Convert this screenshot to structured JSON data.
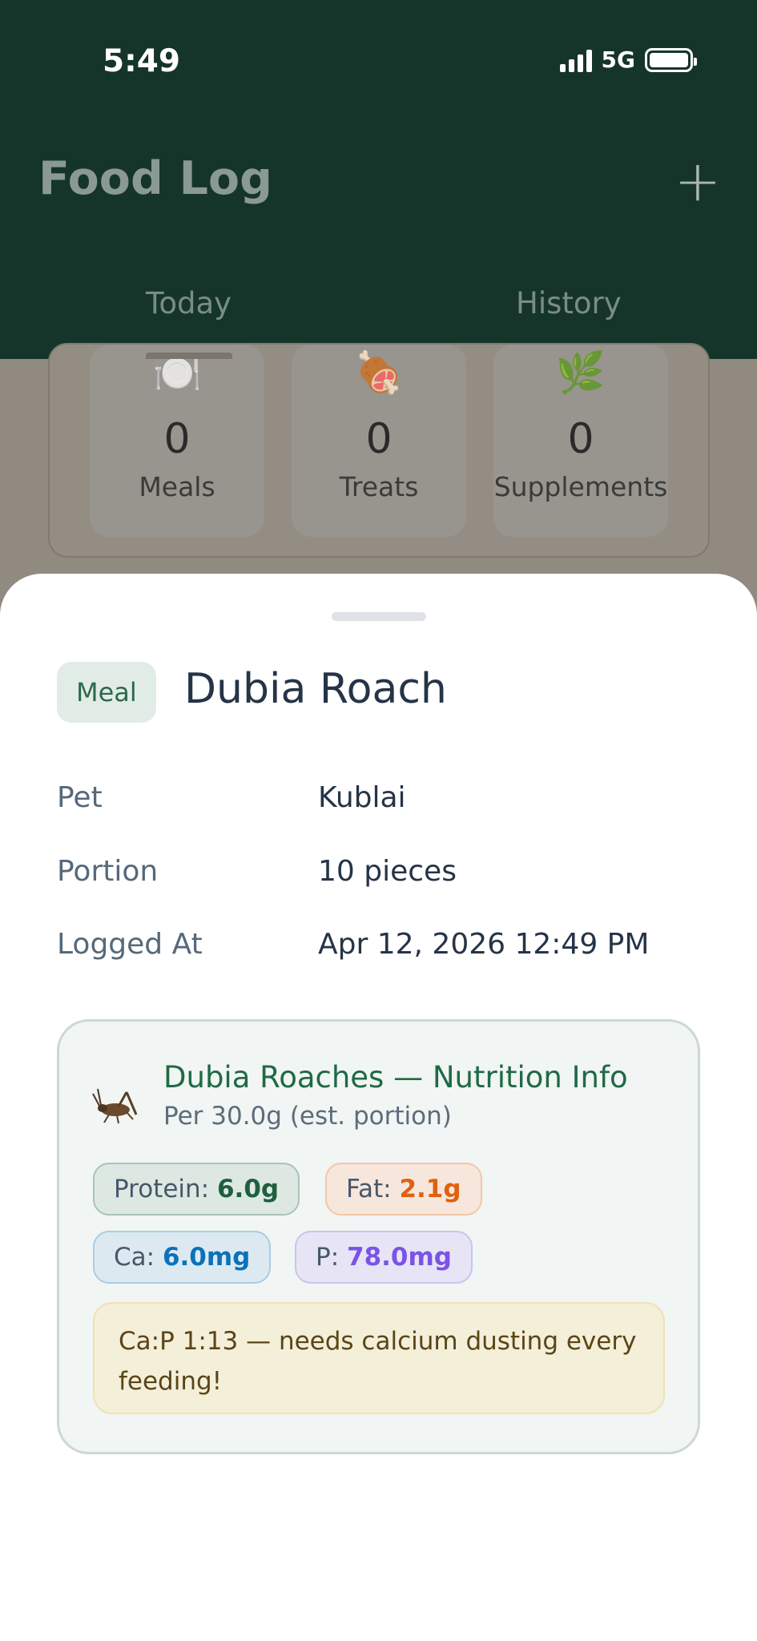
{
  "status_bar": {
    "time": "5:49",
    "network": "5G"
  },
  "header": {
    "title": "Food Log",
    "add_label": "+"
  },
  "tabs": [
    {
      "label": "Today",
      "active": true
    },
    {
      "label": "History",
      "active": false
    }
  ],
  "stats": [
    {
      "icon": "plate-icon",
      "emoji": "🍽️",
      "value": "0",
      "label": "Meals"
    },
    {
      "icon": "meat-icon",
      "emoji": "🍖",
      "value": "0",
      "label": "Treats"
    },
    {
      "icon": "herb-icon",
      "emoji": "🌿",
      "value": "0",
      "label": "Supplements"
    }
  ],
  "sheet": {
    "type_badge": "Meal",
    "name": "Dubia Roach",
    "details": [
      {
        "key": "Pet",
        "value": "Kublai"
      },
      {
        "key": "Portion",
        "value": "10 pieces"
      },
      {
        "key": "Logged At",
        "value": "Apr 12, 2026 12:49 PM"
      }
    ],
    "nutrition": {
      "icon": "cricket-icon",
      "title": "Dubia Roaches — Nutrition Info",
      "subtitle": "Per 30.0g (est. portion)",
      "protein_label": "Protein: ",
      "protein_value": "6.0g",
      "fat_label": "Fat: ",
      "fat_value": "2.1g",
      "ca_label": "Ca: ",
      "ca_value": "6.0mg",
      "p_label": "P: ",
      "p_value": "78.0mg",
      "warning": "Ca:P 1:13 — needs calcium dusting every feeding!"
    }
  },
  "colors": {
    "header_bg": "#16352a",
    "accent_green": "#1f6a44",
    "fat": "#e0610f",
    "calcium": "#0c72b8",
    "phosphorus": "#7b53e6"
  }
}
